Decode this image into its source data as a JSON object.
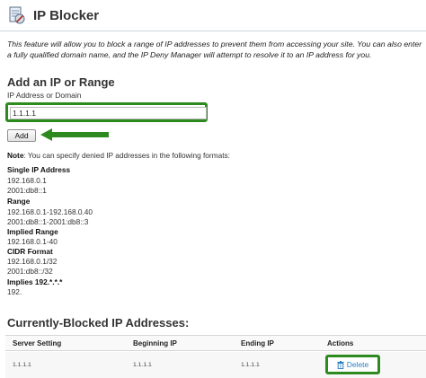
{
  "header": {
    "title": "IP Blocker"
  },
  "intro": "This feature will allow you to block a range of IP addresses to prevent them from accessing your site. You can also enter a fully qualified domain name, and the IP Deny Manager will attempt to resolve it to an IP address for you.",
  "add_section": {
    "title": "Add an IP or Range",
    "field_label": "IP Address or Domain",
    "field_value": "1.1.1.1",
    "add_button": "Add"
  },
  "note": {
    "label": "Note",
    "text": ": You can specify denied IP addresses in the following formats:"
  },
  "formats": [
    {
      "heading": "Single IP Address",
      "examples": [
        "192.168.0.1",
        "2001:db8::1"
      ]
    },
    {
      "heading": "Range",
      "examples": [
        "192.168.0.1-192.168.0.40",
        "2001:db8::1-2001:db8::3"
      ]
    },
    {
      "heading": "Implied Range",
      "examples": [
        "192.168.0.1-40"
      ]
    },
    {
      "heading": "CIDR Format",
      "examples": [
        "192.168.0.1/32",
        "2001:db8::/32"
      ]
    },
    {
      "heading": "Implies 192.*.*.*",
      "examples": [
        "192."
      ]
    }
  ],
  "blocked": {
    "title": "Currently-Blocked IP Addresses:",
    "columns": [
      "Server Setting",
      "Beginning IP",
      "Ending IP",
      "Actions"
    ],
    "rows": [
      {
        "server_setting": "1.1.1.1",
        "beginning_ip": "1.1.1.1",
        "ending_ip": "1.1.1.1",
        "action": "Delete"
      }
    ]
  },
  "colors": {
    "highlight": "#2d8a1f",
    "link": "#2f7fc0"
  }
}
